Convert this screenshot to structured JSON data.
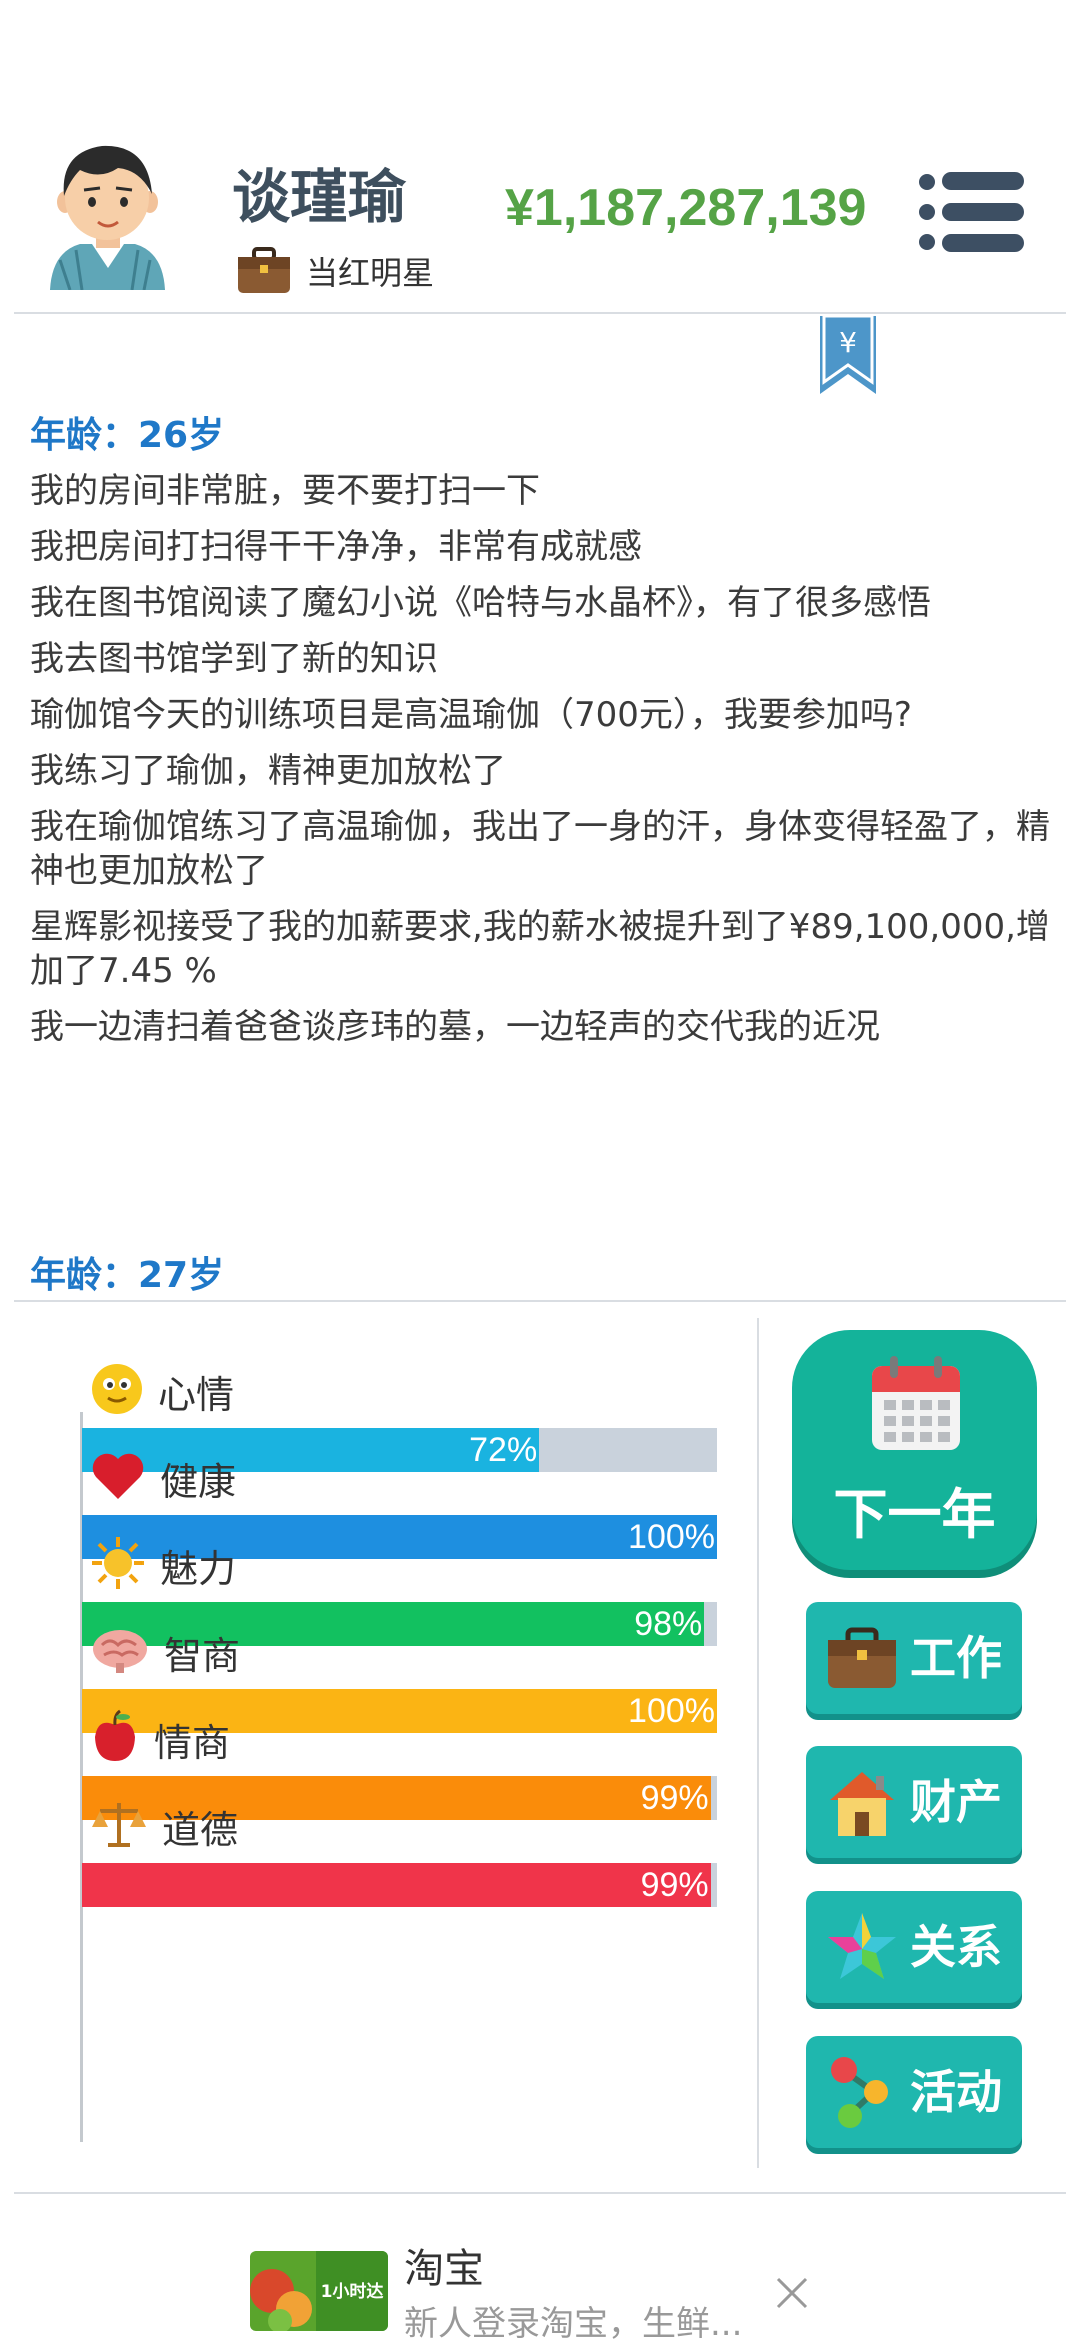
{
  "player": {
    "name": "谈瑾瑜",
    "job": "当红明星",
    "money": "¥1,187,287,139"
  },
  "icons": {
    "avatar": "avatar-icon",
    "job": "briefcase-icon",
    "menu": "menu-icon",
    "bookmark": "yen-bookmark-icon"
  },
  "log": {
    "age_heading": "年龄：26岁",
    "lines": [
      "我的房间非常脏，要不要打扫一下",
      "我把房间打扫得干干净净，非常有成就感",
      "我在图书馆阅读了魔幻小说《哈特与水晶杯》，有了很多感悟",
      "我去图书馆学到了新的知识",
      "瑜伽馆今天的训练项目是高温瑜伽（700元），我要参加吗?",
      "我练习了瑜伽，精神更加放松了",
      "我在瑜伽馆练习了高温瑜伽，我出了一身的汗，身体变得轻盈了，精神也更加放松了",
      "星辉影视接受了我的加薪要求,我的薪水被提升到了¥89,100,000,增加了7.45 %",
      "我一边清扫着爸爸谈彦玮的墓，一边轻声的交代我的近况"
    ],
    "next_age_heading": "年龄：27岁"
  },
  "stats": [
    {
      "label": "心情",
      "value": 72,
      "pct": "72%",
      "color": "#1ab3e0",
      "icon": "smiley-icon"
    },
    {
      "label": "健康",
      "value": 100,
      "pct": "100%",
      "color": "#1e8fe0",
      "icon": "heart-icon"
    },
    {
      "label": "魅力",
      "value": 98,
      "pct": "98%",
      "color": "#12c160",
      "icon": "sun-icon"
    },
    {
      "label": "智商",
      "value": 100,
      "pct": "100%",
      "color": "#fbb414",
      "icon": "brain-icon"
    },
    {
      "label": "情商",
      "value": 99,
      "pct": "99%",
      "color": "#fa8c0a",
      "icon": "apple-icon"
    },
    {
      "label": "道德",
      "value": 99,
      "pct": "99%",
      "color": "#f0344a",
      "icon": "scale-icon"
    }
  ],
  "actions": {
    "next_year": "下一年",
    "work": "工作",
    "property": "财产",
    "relations": "关系",
    "activities": "活动"
  },
  "ad": {
    "title": "淘宝",
    "description": "新人登录淘宝，生鲜...",
    "image_text": "1小时达"
  },
  "colors": {
    "money": "#55a346",
    "age_heading": "#1f78c8",
    "button_teal": "#1fb7ae",
    "next_year_green": "#14b39a"
  }
}
